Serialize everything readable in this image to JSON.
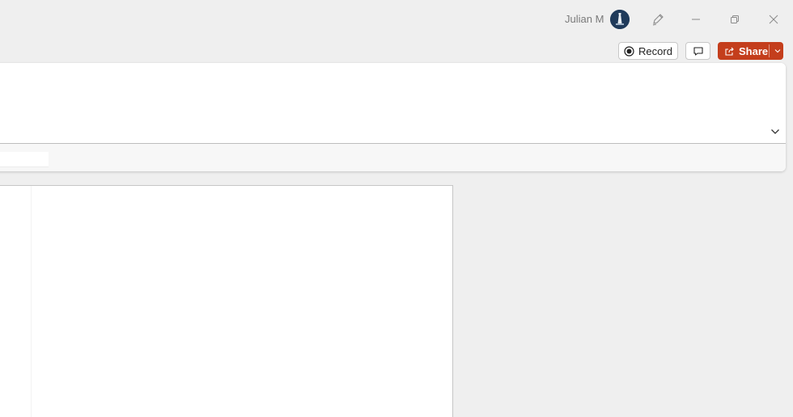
{
  "titlebar": {
    "user_name": "Julian M",
    "avatar_icon": "avatar-lighthouse-icon",
    "pen_icon": "pen-icon",
    "minimize_icon": "minimize-icon",
    "restore_icon": "restore-icon",
    "close_icon": "close-icon"
  },
  "actions": {
    "record_label": "Record",
    "record_icon": "record-icon",
    "comments_icon": "comment-icon",
    "share_label": "Share",
    "share_icon": "share-icon",
    "share_dropdown_icon": "chevron-down-icon"
  },
  "ribbon": {
    "collapse_icon": "chevron-down-icon"
  },
  "colors": {
    "background": "#efefef",
    "share_accent": "#c43e1c",
    "avatar": "#1f3a5a"
  }
}
